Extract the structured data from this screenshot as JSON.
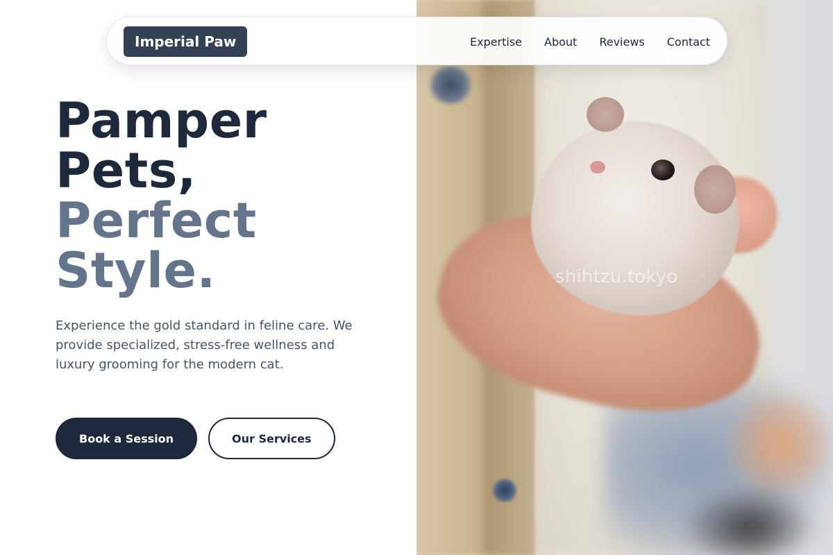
{
  "brand": {
    "name": "Imperial Paw"
  },
  "nav": {
    "links": [
      {
        "label": "Expertise"
      },
      {
        "label": "About"
      },
      {
        "label": "Reviews"
      },
      {
        "label": "Contact"
      }
    ]
  },
  "hero": {
    "headline_line1": "Pamper",
    "headline_line2": "Pets,",
    "headline_line3": "Perfect",
    "headline_line4": "Style.",
    "description": "Experience the gold standard in feline care. We provide specialized, stress-free wellness and luxury grooming for the modern cat.",
    "primary_cta": "Book a Session",
    "secondary_cta": "Our Services"
  },
  "photo": {
    "watermark": "shihtzu.tokyo",
    "subject": "hamster-in-hand"
  },
  "colors": {
    "headline_dark": "#1e293b",
    "headline_muted": "#64748b",
    "body_text": "#475569",
    "brand_bg": "#334155",
    "button_dark": "#1e293b"
  }
}
